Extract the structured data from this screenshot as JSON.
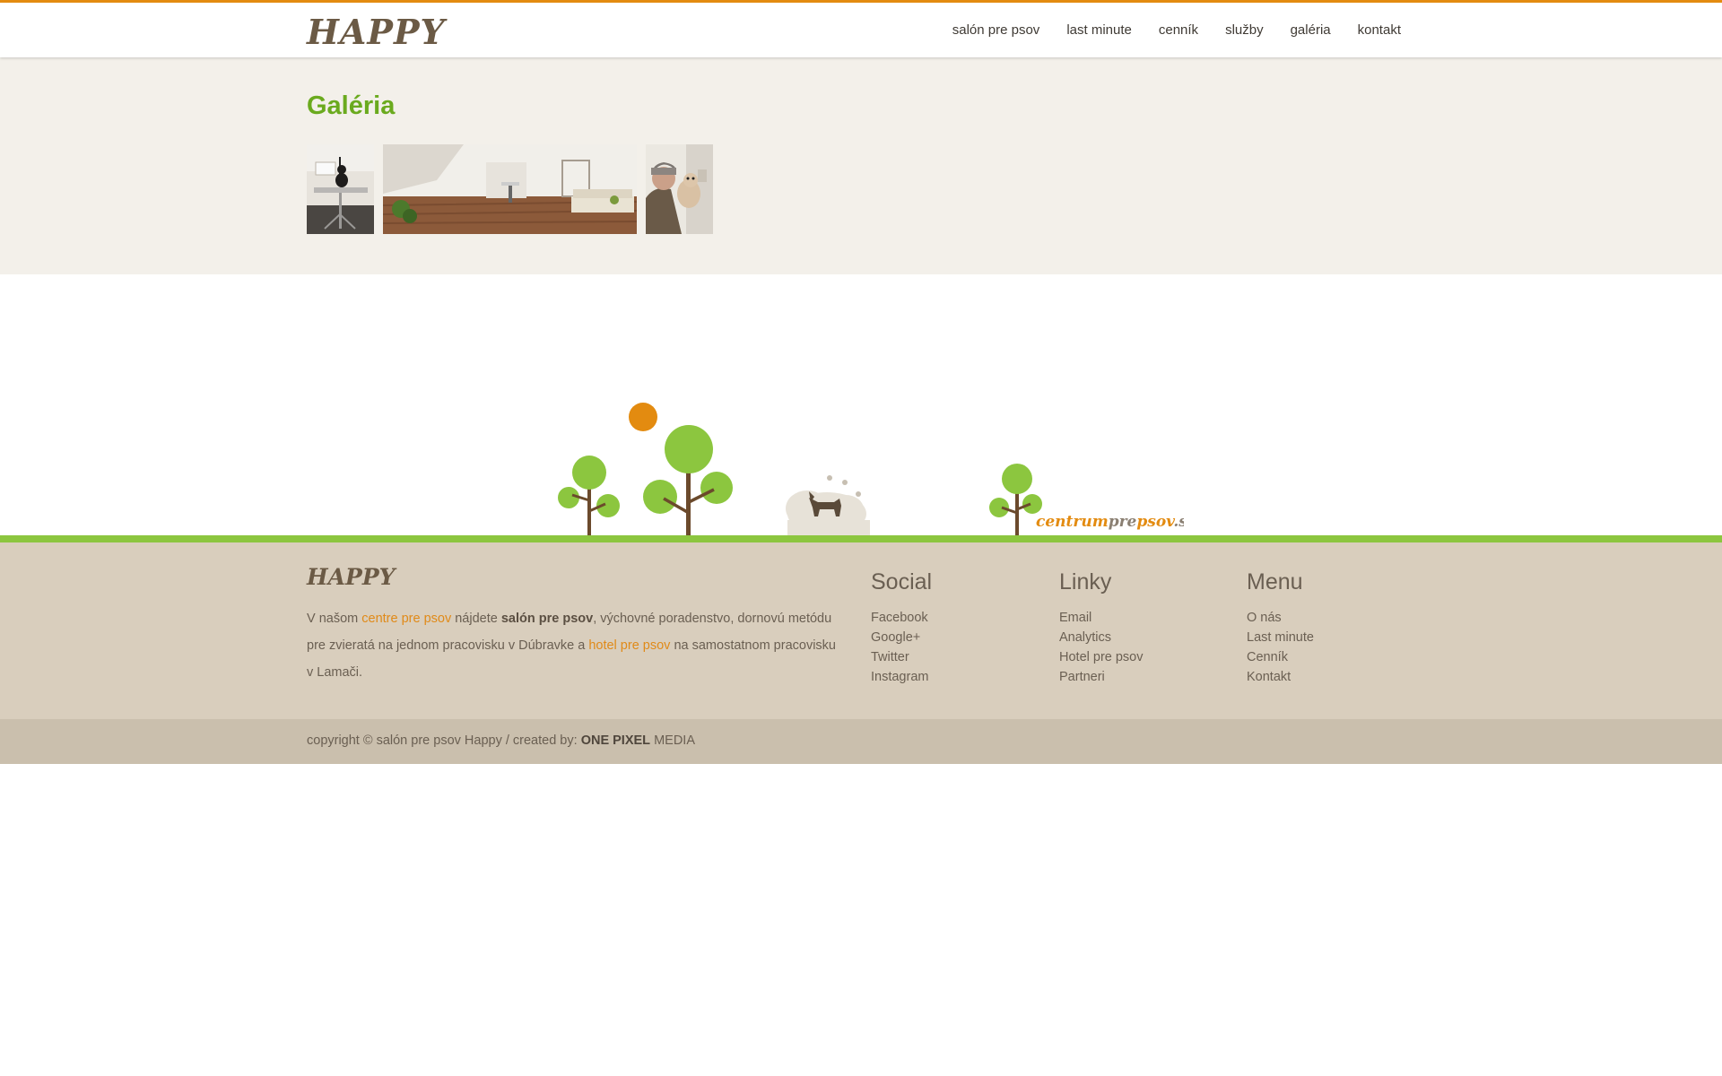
{
  "header": {
    "logo": "HAPPY",
    "nav": [
      "salón pre psov",
      "last minute",
      "cenník",
      "služby",
      "galéria",
      "kontakt"
    ]
  },
  "gallery": {
    "title": "Galéria",
    "images": [
      {
        "alt": "Grooming table with dog"
      },
      {
        "alt": "Salon interior"
      },
      {
        "alt": "Man holding puppy"
      }
    ]
  },
  "illustration": {
    "brand_part1": "centrum",
    "brand_part2": "pre",
    "brand_part3": "psov",
    "brand_part4": ".sk"
  },
  "footer": {
    "logo": "HAPPY",
    "text": {
      "t1": "V našom ",
      "link1": "centre pre psov",
      "t2": " nájdete ",
      "bold1": "salón pre psov",
      "t3": ", výchovné poradenstvo, dornovú metódu pre zvieratá na jednom pracovisku v Dúbravke a ",
      "link2": "hotel pre psov",
      "t4": " na samostatnom pracovisku v Lamači."
    },
    "social": {
      "title": "Social",
      "items": [
        "Facebook",
        "Google+",
        "Twitter",
        "Instagram"
      ]
    },
    "links": {
      "title": "Linky",
      "items": [
        "Email",
        "Analytics",
        "Hotel pre psov",
        "Partneri"
      ]
    },
    "menu": {
      "title": "Menu",
      "items": [
        "O nás",
        "Last minute",
        "Cenník",
        "Kontakt"
      ]
    }
  },
  "copyright": {
    "text": "copyright © salón pre psov Happy / created by: ",
    "brand_bold": "ONE PIXEL",
    "brand_rest": " MEDIA"
  },
  "colors": {
    "accent_orange": "#e38b10",
    "accent_green": "#8cc63f",
    "title_green": "#6aaa1e",
    "footer_bg": "#d9cebd"
  }
}
